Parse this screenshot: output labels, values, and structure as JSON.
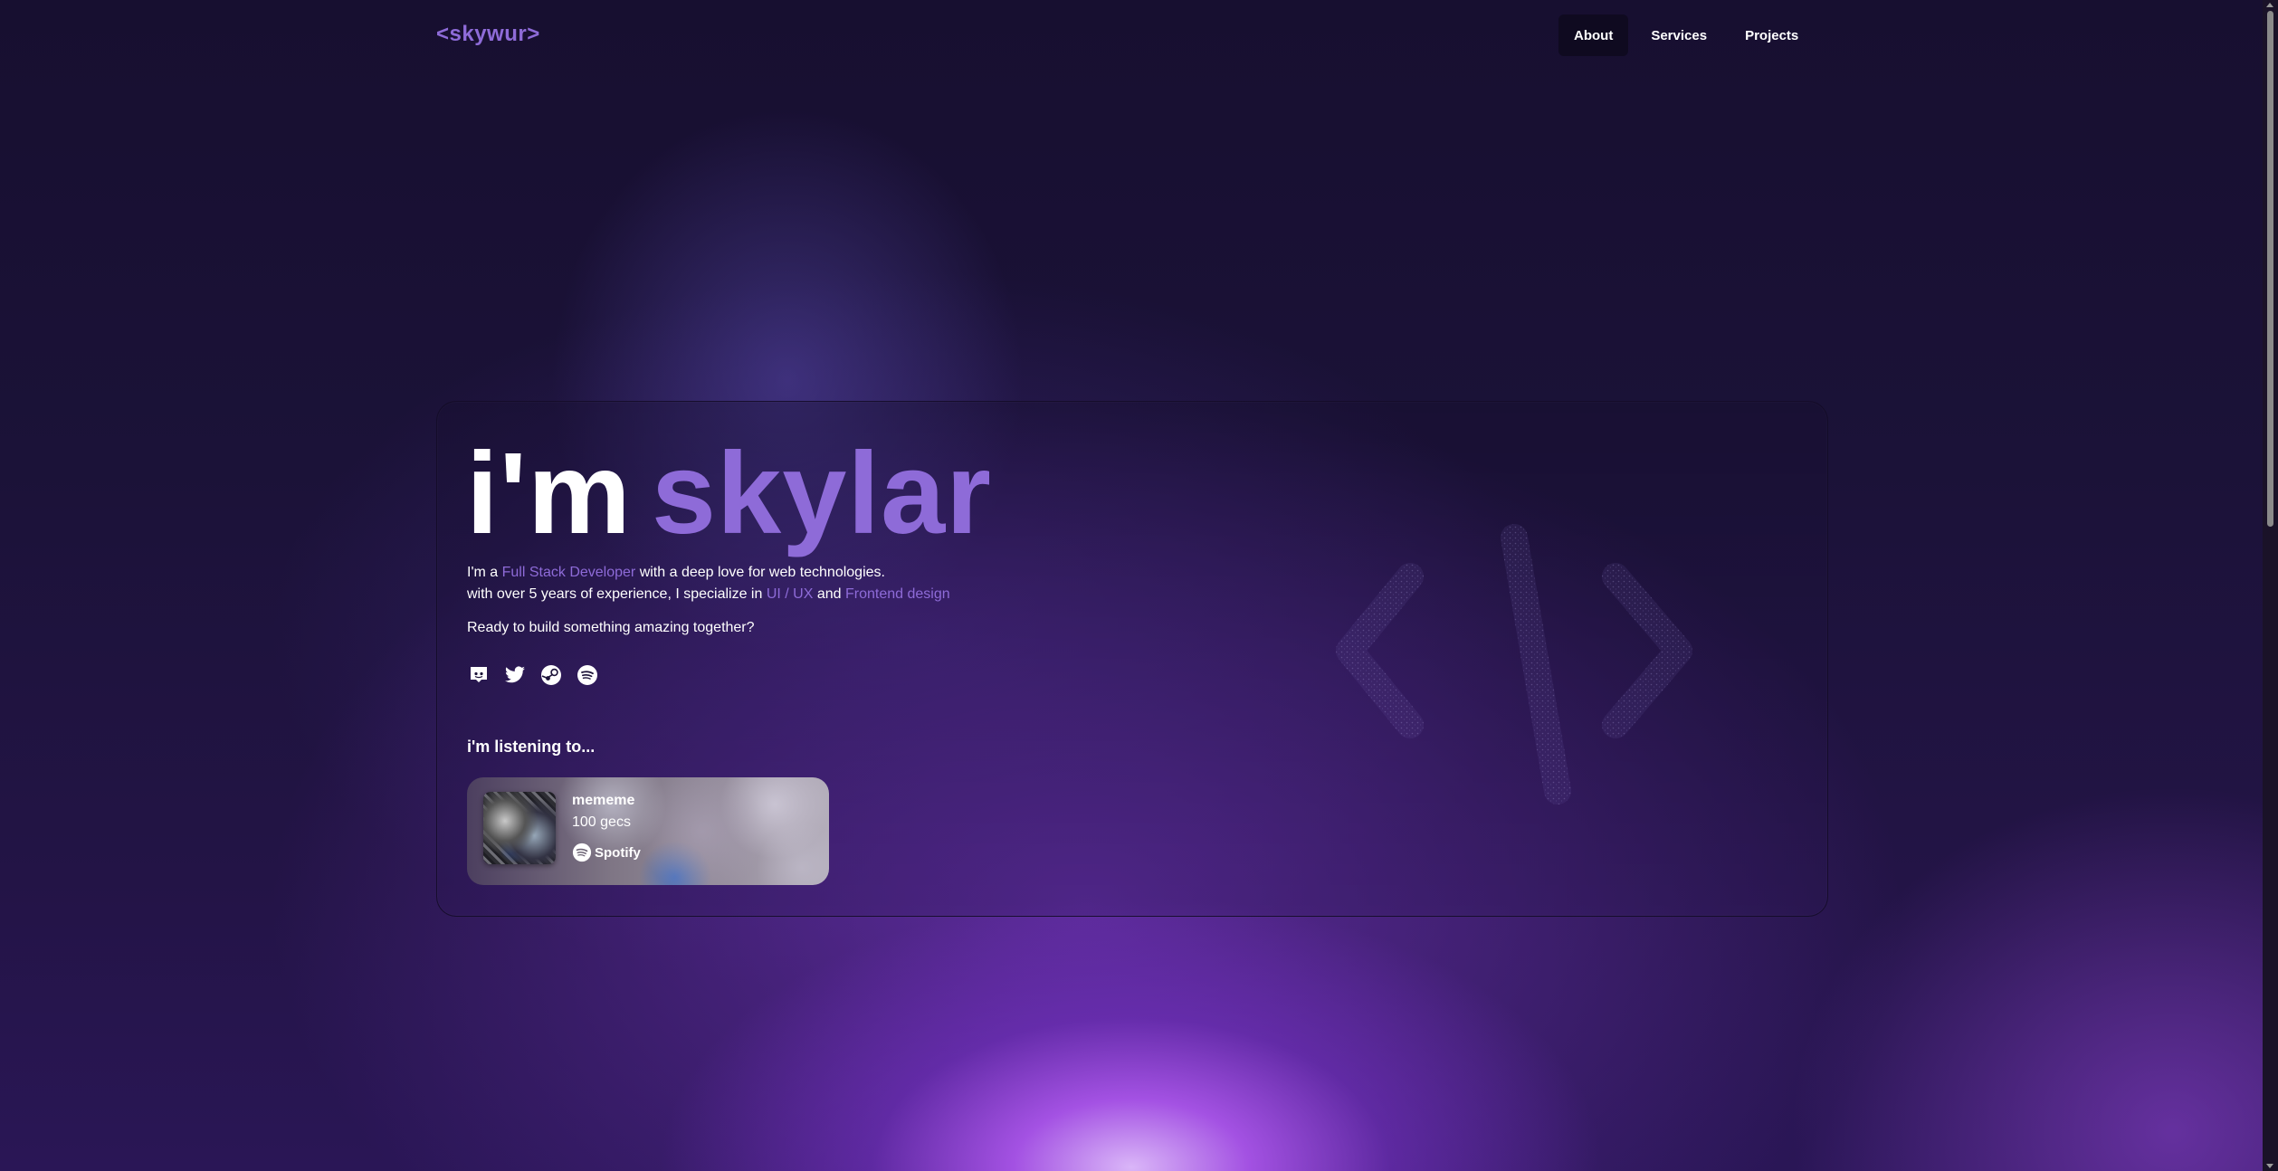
{
  "header": {
    "logo": "<skywur>",
    "nav": [
      {
        "label": "About",
        "active": true
      },
      {
        "label": "Services",
        "active": false
      },
      {
        "label": "Projects",
        "active": false
      }
    ]
  },
  "hero": {
    "greeting": "i'm",
    "name": "skylar",
    "intro": {
      "line1_prefix": "I'm a ",
      "role": "Full Stack Developer",
      "line1_suffix": " with a deep love for web technologies.",
      "line2_prefix": "with over 5 years of experience, I specialize in ",
      "specialty1": "UI / UX",
      "line2_middle": " and ",
      "specialty2": "Frontend design"
    },
    "cta": "Ready to build something amazing together?",
    "socials": [
      "discord-icon",
      "twitter-icon",
      "steam-icon",
      "spotify-icon"
    ],
    "listening_heading": "i'm listening to...",
    "now_playing": {
      "track": "mememe",
      "artist": "100 gecs",
      "service": "Spotify"
    }
  },
  "colors": {
    "accent": "#8e6bd8",
    "background": "#170f30",
    "nav_active_bg": "#0f0a20"
  }
}
